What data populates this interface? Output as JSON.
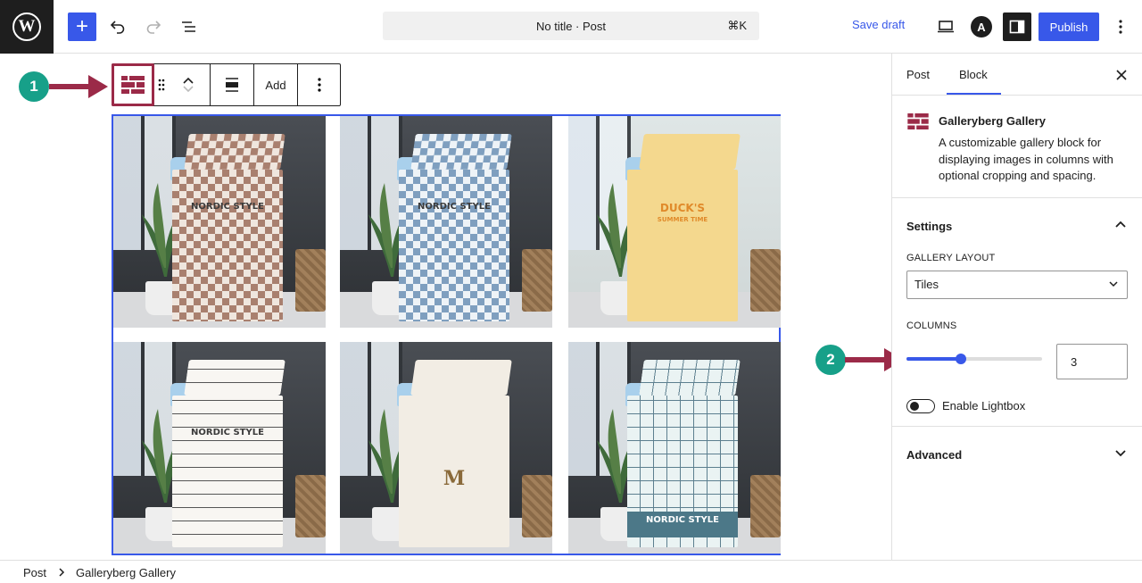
{
  "header": {
    "command_title": "No title · Post",
    "command_shortcut": "⌘K",
    "save_draft_label": "Save draft",
    "publish_label": "Publish",
    "wp_logo": "W",
    "astra_logo": "A"
  },
  "block_toolbar": {
    "add_label": "Add"
  },
  "annotations": {
    "marker_1": "1",
    "marker_2": "2",
    "accent_color": "#9b2a48",
    "marker_color": "#17a089"
  },
  "gallery": {
    "tiles": [
      {
        "name": "brown-checkered-cover",
        "label": "NORDIC STYLE",
        "pattern": "brown-check",
        "color": "#b48c7c"
      },
      {
        "name": "blue-checkered-cover",
        "label": "NORDIC STYLE",
        "pattern": "blue-check",
        "color": "#8fa8c1"
      },
      {
        "name": "duck-yellow-cover",
        "label": "DUCK'S",
        "sublabel": "SUMMER TIME",
        "pattern": "yellow",
        "color": "#f3d58a"
      },
      {
        "name": "white-grid-corgi-cover",
        "label": "NORDIC STYLE",
        "pattern": "white-grid",
        "color": "#f6f3ee"
      },
      {
        "name": "cream-wreath-cover",
        "label": "M",
        "pattern": "cream",
        "color": "#f1ece3"
      },
      {
        "name": "mint-grid-bunny-cover",
        "label": "NORDIC STYLE",
        "pattern": "mint-grid",
        "color": "#e2eef0"
      }
    ]
  },
  "sidebar": {
    "tabs": [
      {
        "label": "Post",
        "active": false
      },
      {
        "label": "Block",
        "active": true
      }
    ],
    "block": {
      "title": "Galleryberg Gallery",
      "description": "A customizable gallery block for displaying images in columns with optional cropping and spacing."
    },
    "settings": {
      "title": "Settings",
      "gallery_layout_label": "GALLERY LAYOUT",
      "gallery_layout_value": "Tiles",
      "columns_label": "COLUMNS",
      "columns_value": "3",
      "columns_fraction": 0.4,
      "lightbox_label": "Enable Lightbox",
      "lightbox_enabled": false
    },
    "advanced": {
      "title": "Advanced"
    }
  },
  "breadcrumb": {
    "items": [
      "Post",
      "Galleryberg Gallery"
    ]
  },
  "colors": {
    "accent": "#3858e9",
    "dark": "#1e1e1e"
  }
}
